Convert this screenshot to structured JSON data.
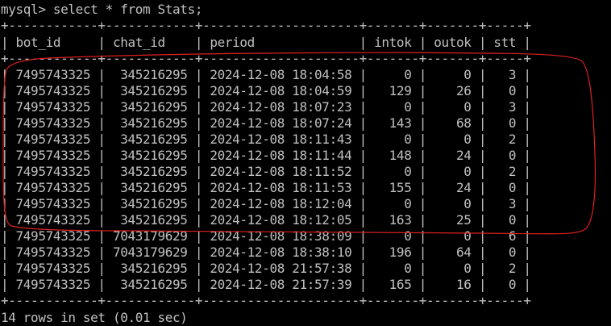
{
  "terminal": {
    "command_line": "mysql> select * from Stats;",
    "table": {
      "border": "+------------+------------+---------------------+-------+-------+-----+",
      "header": "| bot_id     | chat_id    | period              | intok | outok | stt |",
      "rows": [
        "| 7495743325 |  345216295 | 2024-12-08 18:04:58 |     0 |     0 |   3 |",
        "| 7495743325 |  345216295 | 2024-12-08 18:04:59 |   129 |    26 |   0 |",
        "| 7495743325 |  345216295 | 2024-12-08 18:07:23 |     0 |     0 |   3 |",
        "| 7495743325 |  345216295 | 2024-12-08 18:07:24 |   143 |    68 |   0 |",
        "| 7495743325 |  345216295 | 2024-12-08 18:11:43 |     0 |     0 |   2 |",
        "| 7495743325 |  345216295 | 2024-12-08 18:11:44 |   148 |    24 |   0 |",
        "| 7495743325 |  345216295 | 2024-12-08 18:11:52 |     0 |     0 |   2 |",
        "| 7495743325 |  345216295 | 2024-12-08 18:11:53 |   155 |    24 |   0 |",
        "| 7495743325 |  345216295 | 2024-12-08 18:12:04 |     0 |     0 |   3 |",
        "| 7495743325 |  345216295 | 2024-12-08 18:12:05 |   163 |    25 |   0 |",
        "| 7495743325 | 7043179629 | 2024-12-08 18:38:09 |     0 |     0 |   6 |",
        "| 7495743325 | 7043179629 | 2024-12-08 18:38:10 |   196 |    64 |   0 |",
        "| 7495743325 |  345216295 | 2024-12-08 21:57:38 |     0 |     0 |   2 |",
        "| 7495743325 |  345216295 | 2024-12-08 21:57:39 |   165 |    16 |   0 |"
      ]
    },
    "result_line": "14 rows in set (0.01 sec)"
  },
  "colors": {
    "background": "#000000",
    "text": "#c0c0c0",
    "annotation": "#e02020"
  }
}
